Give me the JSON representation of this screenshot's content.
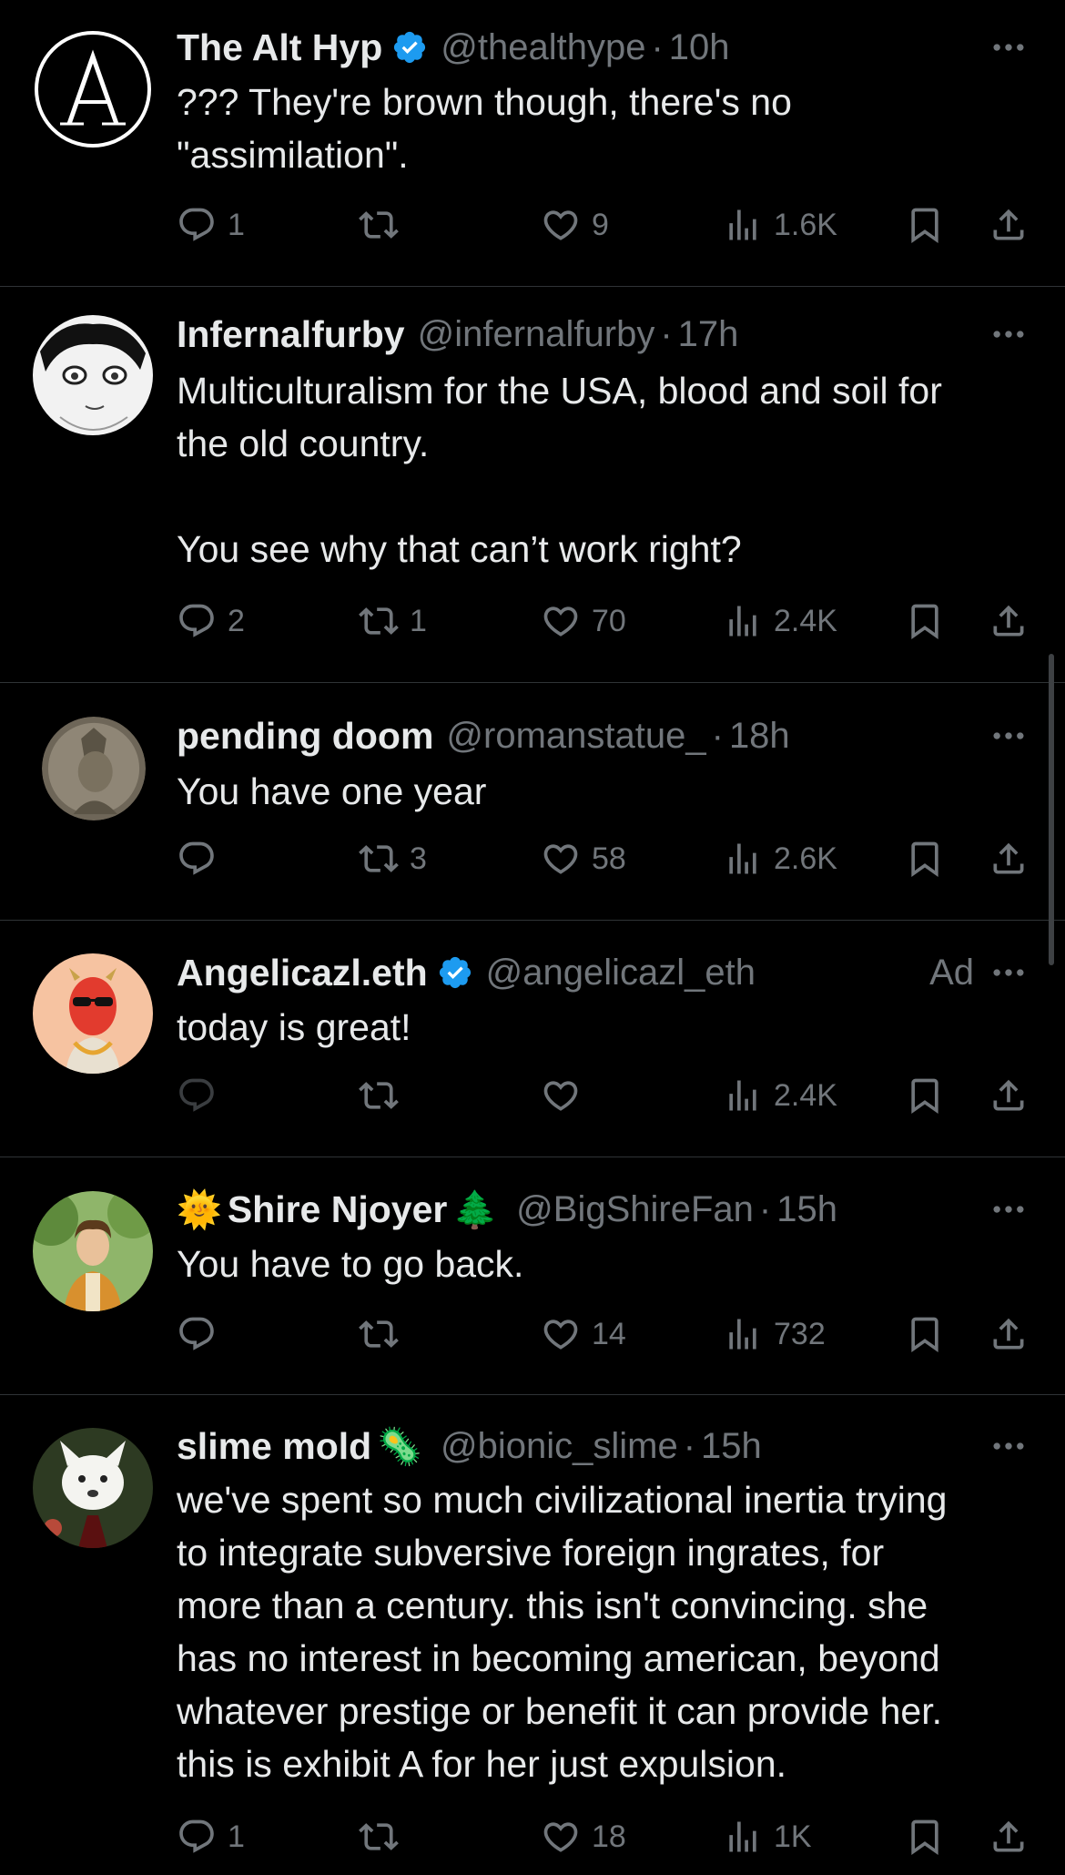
{
  "tweets": [
    {
      "name": "The Alt Hyp",
      "handle": "@thealthype",
      "time": "10h",
      "verified": true,
      "text": "??? They're brown though, there's no\n\"assimilation\".",
      "replies": "1",
      "reposts": "",
      "likes": "9",
      "views": "1.6K"
    },
    {
      "name": "Infernalfurby",
      "handle": "@infernalfurby",
      "time": "17h",
      "text": "Multiculturalism for the USA, blood and soil for\nthe old country.\n\nYou see why that can’t work right?",
      "replies": "2",
      "reposts": "1",
      "likes": "70",
      "views": "2.4K"
    },
    {
      "name": "pending doom",
      "handle": "@romanstatue_",
      "time": "18h",
      "text": "You have one year",
      "replies": "",
      "reposts": "3",
      "likes": "58",
      "views": "2.6K"
    },
    {
      "name": "Angelicazl.eth",
      "handle": "@angelicazl_eth",
      "ad_label": "Ad",
      "verified": true,
      "text": "today is great!",
      "replies": "",
      "reposts": "",
      "likes": "",
      "views": "2.4K"
    },
    {
      "name_prefix_emoji": "🌞",
      "name": "Shire Njoyer",
      "name_suffix_emoji": "🌲",
      "handle": "@BigShireFan",
      "time": "15h",
      "text": "You have to go back.",
      "replies": "",
      "reposts": "",
      "likes": "14",
      "views": "732"
    },
    {
      "name": "slime mold",
      "name_suffix_emoji": "🦠",
      "handle": "@bionic_slime",
      "time": "15h",
      "text": "we've spent so much civilizational inertia trying\nto integrate subversive foreign ingrates, for\nmore than a century. this isn't convincing. she\nhas no interest in becoming american, beyond\nwhatever prestige or benefit it can provide her.\nthis is exhibit A for her just expulsion.",
      "replies": "1",
      "reposts": "",
      "likes": "18",
      "views": "1K"
    }
  ],
  "colors": {
    "background": "#000000",
    "text": "#e7e9ea",
    "muted": "#71767b",
    "verified": "#1d9bf0",
    "divider": "#2f3336"
  },
  "icons": [
    "reply-icon",
    "repost-icon",
    "like-icon",
    "views-icon",
    "bookmark-icon",
    "share-icon",
    "more-icon",
    "verified-badge-icon"
  ]
}
